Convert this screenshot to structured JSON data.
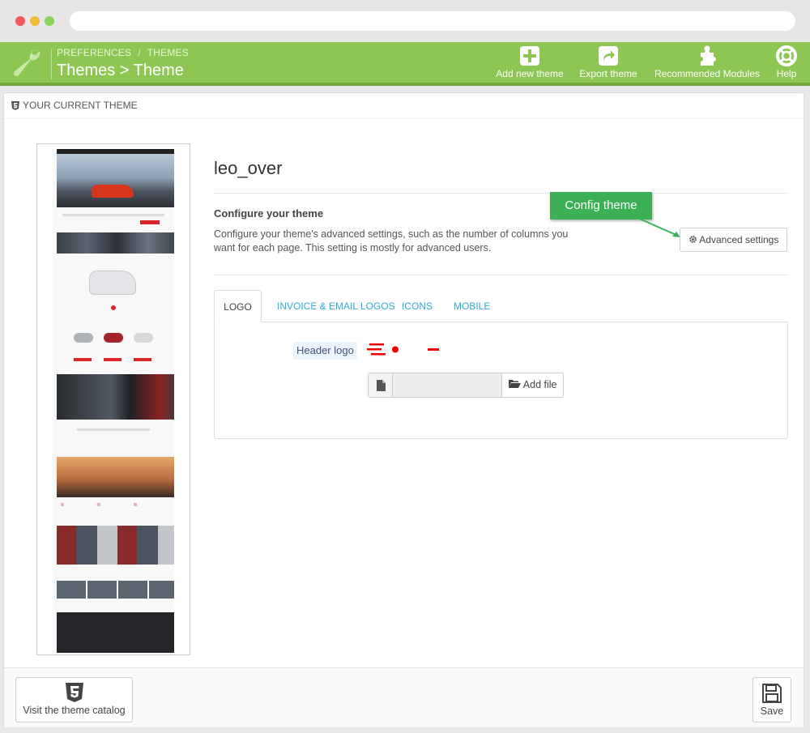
{
  "header": {
    "breadcrumb": [
      "PREFERENCES",
      "THEMES"
    ],
    "title": "Themes > Theme",
    "toolbar": [
      {
        "label": "Add new theme",
        "icon": "plus-square-icon"
      },
      {
        "label": "Export theme",
        "icon": "share-icon"
      },
      {
        "label": "Recommended Modules",
        "icon": "puzzle-icon"
      },
      {
        "label": "Help",
        "icon": "lifebuoy-icon"
      }
    ]
  },
  "panel": {
    "heading": "YOUR CURRENT THEME",
    "theme_name": "leo_over",
    "configure_title": "Configure your theme",
    "configure_desc": "Configure your theme's advanced settings, such as the number of columns you want for each page. This setting is mostly for advanced users.",
    "advanced_button": "Advanced settings",
    "callout": "Config theme",
    "tabs": [
      "LOGO",
      "INVOICE & EMAIL LOGOS",
      "ICONS",
      "MOBILE"
    ],
    "active_tab": "LOGO",
    "header_logo_label": "Header logo",
    "file_input_value": "",
    "add_file_button": "Add file"
  },
  "footer": {
    "catalog_button": "Visit the theme catalog",
    "save_button": "Save"
  },
  "colors": {
    "header_green": "#8dc653",
    "callout_green": "#3cb054",
    "link_blue": "#2eacce"
  }
}
